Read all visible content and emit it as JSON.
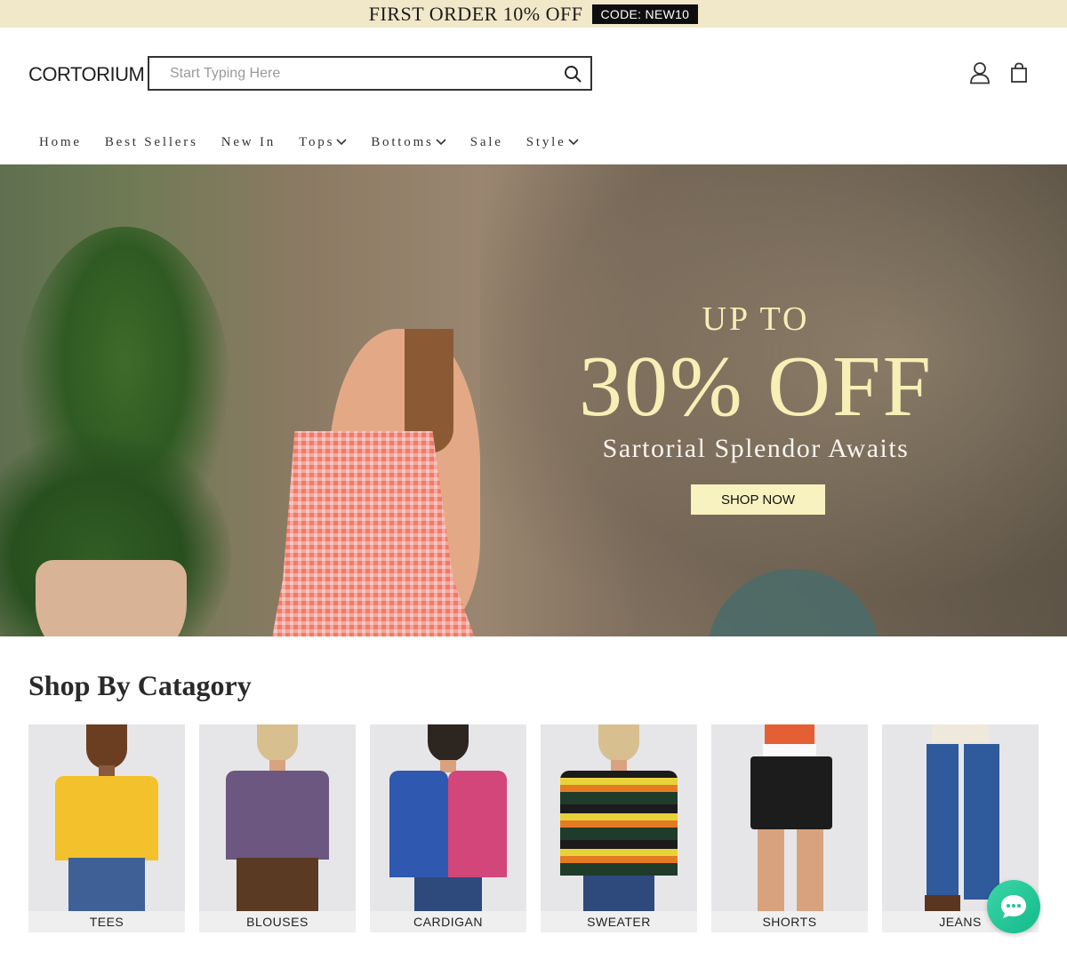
{
  "promo": {
    "text": "FIRST ORDER 10% OFF",
    "code": "CODE: NEW10"
  },
  "header": {
    "logo": "CORTORIUM",
    "search_placeholder": "Start Typing Here",
    "icons": [
      "search-icon",
      "account-icon",
      "shopping-bag-icon"
    ]
  },
  "nav": {
    "items": [
      {
        "label": "Home",
        "dropdown": false
      },
      {
        "label": "Best Sellers",
        "dropdown": false
      },
      {
        "label": "New In",
        "dropdown": false
      },
      {
        "label": "Tops",
        "dropdown": true
      },
      {
        "label": "Bottoms",
        "dropdown": true
      },
      {
        "label": "Sale",
        "dropdown": false
      },
      {
        "label": "Style",
        "dropdown": true
      }
    ]
  },
  "hero": {
    "upto": "UP TO",
    "discount": "30% OFF",
    "subtitle": "Sartorial Splendor Awaits",
    "cta": "SHOP NOW",
    "accent_color": "#f6efb6"
  },
  "categories": {
    "title": "Shop By Catagory",
    "items": [
      {
        "label": "TEES"
      },
      {
        "label": "BLOUSES"
      },
      {
        "label": "CARDIGAN"
      },
      {
        "label": "SWEATER"
      },
      {
        "label": "SHORTS"
      },
      {
        "label": "JEANS"
      }
    ]
  },
  "chat": {
    "icon": "chat-bubble-icon",
    "color": "#1fc496"
  }
}
